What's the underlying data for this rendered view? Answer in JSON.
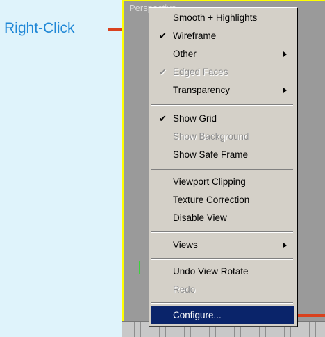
{
  "callout": {
    "label": "Right-Click"
  },
  "viewport": {
    "label": "Perspective"
  },
  "menu": {
    "items": [
      {
        "label": "Smooth + Highlights",
        "checked": false,
        "submenu": false,
        "disabled": false
      },
      {
        "label": "Wireframe",
        "checked": true,
        "submenu": false,
        "disabled": false
      },
      {
        "label": "Other",
        "checked": false,
        "submenu": true,
        "disabled": false
      },
      {
        "label": "Edged Faces",
        "checked": true,
        "submenu": false,
        "disabled": true
      },
      {
        "label": "Transparency",
        "checked": false,
        "submenu": true,
        "disabled": false
      },
      {
        "label": "Show Grid",
        "checked": true,
        "submenu": false,
        "disabled": false
      },
      {
        "label": "Show Background",
        "checked": false,
        "submenu": false,
        "disabled": true
      },
      {
        "label": "Show Safe Frame",
        "checked": false,
        "submenu": false,
        "disabled": false
      },
      {
        "label": "Viewport Clipping",
        "checked": false,
        "submenu": false,
        "disabled": false
      },
      {
        "label": "Texture Correction",
        "checked": false,
        "submenu": false,
        "disabled": false
      },
      {
        "label": "Disable View",
        "checked": false,
        "submenu": false,
        "disabled": false
      },
      {
        "label": "Views",
        "checked": false,
        "submenu": true,
        "disabled": false
      },
      {
        "label": "Undo View Rotate",
        "checked": false,
        "submenu": false,
        "disabled": false
      },
      {
        "label": "Redo",
        "checked": false,
        "submenu": false,
        "disabled": true
      },
      {
        "label": "Configure...",
        "checked": false,
        "submenu": false,
        "disabled": false,
        "highlighted": true
      }
    ],
    "check_glyph": "✔"
  },
  "colors": {
    "highlight": "#0a246a",
    "callout_text": "#1f87d6",
    "callout_line": "#d9411e",
    "viewport_border": "#ffff00"
  }
}
